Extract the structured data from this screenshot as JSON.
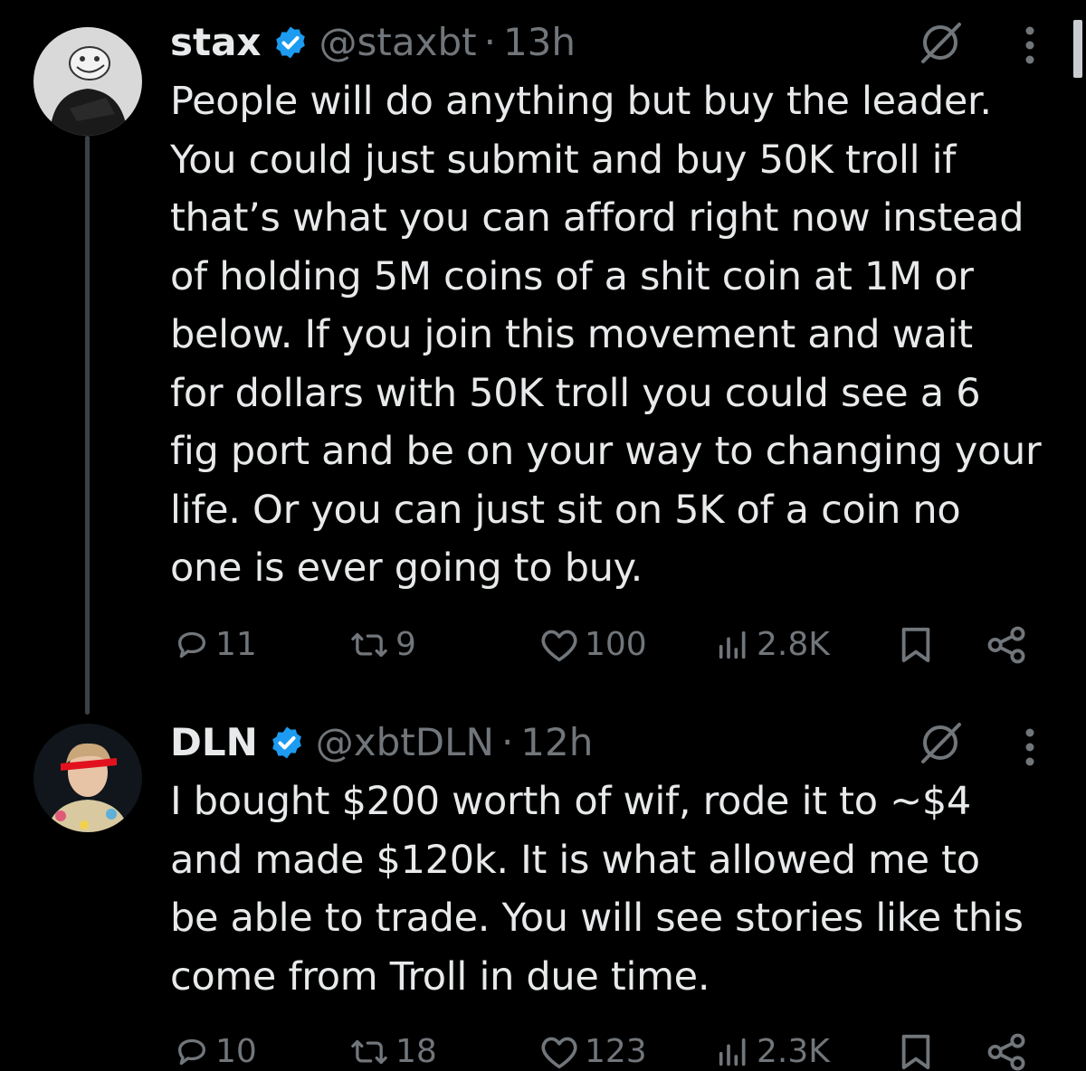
{
  "posts": [
    {
      "display_name": "stax",
      "handle": "@staxbt",
      "separator": "·",
      "time": "13h",
      "text": "People will do anything but buy the leader.\nYou could just submit and buy 50K troll if\nthat’s what you can afford right now instead\nof holding 5M coins of a shit coin at 1M or\nbelow.  If you join this movement and wait\nfor dollars with 50K troll you could see a 6\nfig port and be on your way to changing your\nlife.  Or you can just sit on 5K of a coin no\none is ever going to buy.",
      "replies": "11",
      "reposts": "9",
      "likes": "100",
      "views": "2.8K"
    },
    {
      "display_name": "DLN",
      "handle": "@xbtDLN",
      "separator": "·",
      "time": "12h",
      "text": "I bought $200 worth of wif, rode it to ~$4\nand made $120k. It is what allowed me to\nbe able to trade. You will see stories like this\ncome from Troll in due time.",
      "replies": "10",
      "reposts": "18",
      "likes": "123",
      "views": "2.3K"
    }
  ],
  "colors": {
    "background": "#000000",
    "text": "#e7e9ea",
    "muted": "#71767b",
    "verified": "#1d9bf0",
    "thread_line": "#3d4145"
  },
  "icons": [
    "verified-badge-icon",
    "grok-icon",
    "more-icon",
    "reply-icon",
    "repost-icon",
    "like-icon",
    "views-icon",
    "bookmark-icon",
    "share-icon"
  ]
}
